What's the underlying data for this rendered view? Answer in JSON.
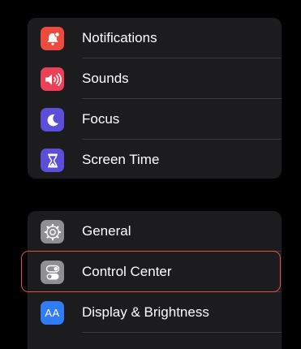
{
  "settings_group_1": {
    "items": [
      {
        "label": "Notifications",
        "icon": "bell-badge-icon",
        "icon_color": "#ec4b3e"
      },
      {
        "label": "Sounds",
        "icon": "speaker-wave-icon",
        "icon_color": "#ea4157"
      },
      {
        "label": "Focus",
        "icon": "moon-icon",
        "icon_color": "#5b4fd9"
      },
      {
        "label": "Screen Time",
        "icon": "hourglass-icon",
        "icon_color": "#5b4fd9"
      }
    ]
  },
  "settings_group_2": {
    "items": [
      {
        "label": "General",
        "icon": "gear-icon",
        "icon_color": "#8e8e93"
      },
      {
        "label": "Control Center",
        "icon": "toggle-switches-icon",
        "icon_color": "#8e8e93",
        "highlighted": true
      },
      {
        "label": "Display & Brightness",
        "icon": "text-size-icon",
        "icon_color": "#2f7cf6",
        "icon_text": "AA"
      }
    ]
  },
  "colors": {
    "background": "#000000",
    "group_background": "#1c1c1e",
    "divider": "#38383a",
    "highlight_border": "#e0514e"
  }
}
